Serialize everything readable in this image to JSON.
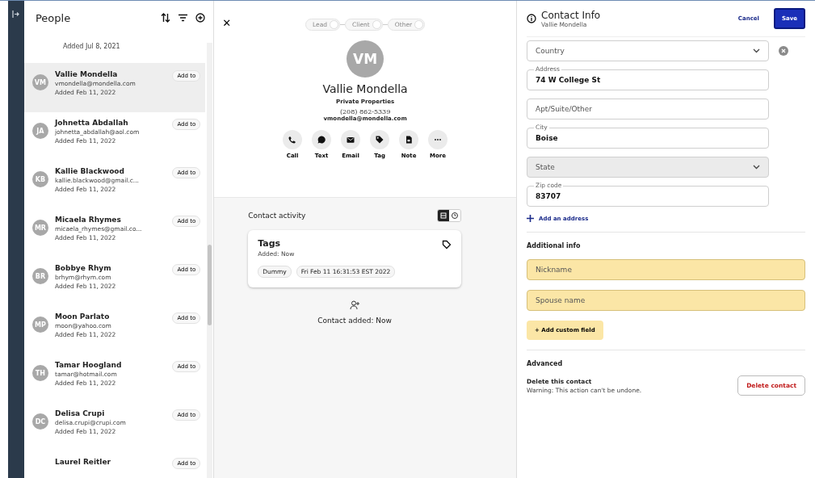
{
  "people_panel": {
    "title": "People",
    "partial_top": {
      "added": "Added Jul 8, 2021"
    },
    "people": [
      {
        "initials": "VM",
        "name": "Vallie Mondella",
        "email": "vmondella@mondella.com",
        "added": "Added Feb 11, 2022",
        "button": "Add to",
        "selected": true
      },
      {
        "initials": "JA",
        "name": "Johnetta Abdallah",
        "email": "johnetta_abdallah@aol.com",
        "added": "Added Feb 11, 2022",
        "button": "Add to",
        "selected": false
      },
      {
        "initials": "KB",
        "name": "Kallie Blackwood",
        "email": "kallie.blackwood@gmail.c...",
        "added": "Added Feb 11, 2022",
        "button": "Add to",
        "selected": false
      },
      {
        "initials": "MR",
        "name": "Micaela Rhymes",
        "email": "micaela_rhymes@gmail.co...",
        "added": "Added Feb 11, 2022",
        "button": "Add to",
        "selected": false
      },
      {
        "initials": "BR",
        "name": "Bobbye Rhym",
        "email": "brhym@rhym.com",
        "added": "Added Feb 11, 2022",
        "button": "Add to",
        "selected": false
      },
      {
        "initials": "MP",
        "name": "Moon Parlato",
        "email": "moon@yahoo.com",
        "added": "Added Feb 11, 2022",
        "button": "Add to",
        "selected": false
      },
      {
        "initials": "TH",
        "name": "Tamar Hoogland",
        "email": "tamar@hotmail.com",
        "added": "Added Feb 11, 2022",
        "button": "Add to",
        "selected": false
      },
      {
        "initials": "DC",
        "name": "Delisa Crupi",
        "email": "delisa.crupi@crupi.com",
        "added": "Added Feb 11, 2022",
        "button": "Add to",
        "selected": false
      },
      {
        "name": "Laurel Reitler",
        "button": "Add to",
        "selected": false
      }
    ]
  },
  "contact": {
    "close": "✕",
    "stages": [
      {
        "label": "Lead",
        "selected": false
      },
      {
        "label": "Client",
        "selected": false
      },
      {
        "label": "Other",
        "selected": false
      }
    ],
    "initials": "VM",
    "name": "Vallie Mondella",
    "company": "Private Properties",
    "phone": "(208) 862-5339",
    "email": "vmondella@mondella.com",
    "actions": [
      {
        "kind": "call",
        "label": "Call"
      },
      {
        "kind": "text",
        "label": "Text"
      },
      {
        "kind": "email",
        "label": "Email"
      },
      {
        "kind": "tag",
        "label": "Tag"
      },
      {
        "kind": "note",
        "label": "Note"
      },
      {
        "kind": "more",
        "label": "More"
      }
    ],
    "activity": {
      "title": "Contact activity",
      "views": [
        {
          "kind": "list",
          "selected": true
        },
        {
          "kind": "history",
          "selected": false
        }
      ],
      "card": {
        "title": "Tags",
        "subtitle": "Added: Now",
        "chips": [
          "Dummy",
          "Fri Feb 11 16:31:53 EST 2022"
        ]
      },
      "event": "Contact added: Now"
    }
  },
  "contact_info": {
    "title": "Contact Info",
    "subtitle": "Vallie Mondella",
    "cancel": "Cancel",
    "save": "Save",
    "fields": [
      {
        "kind": "select",
        "placeholder": "Country",
        "disabled": false,
        "removable": true
      },
      {
        "kind": "text",
        "label": "Address",
        "value": "74 W College St"
      },
      {
        "kind": "text",
        "placeholder": "Apt/Suite/Other"
      },
      {
        "kind": "text",
        "label": "City",
        "value": "Boise"
      },
      {
        "kind": "select",
        "placeholder": "State",
        "disabled": true,
        "removable": false
      },
      {
        "kind": "text",
        "label": "Zip code",
        "value": "83707"
      }
    ],
    "add_address": "Add an address",
    "additional": {
      "title": "Additional info",
      "fields": [
        {
          "placeholder": "Nickname",
          "highlighted": true
        },
        {
          "placeholder": "Spouse name",
          "highlighted": true
        }
      ],
      "add_button": "+ Add custom field"
    },
    "advanced": {
      "title": "Advanced",
      "delete_title": "Delete this contact",
      "warning": "Warning: This action can't be undone.",
      "delete_button": "Delete contact"
    }
  }
}
